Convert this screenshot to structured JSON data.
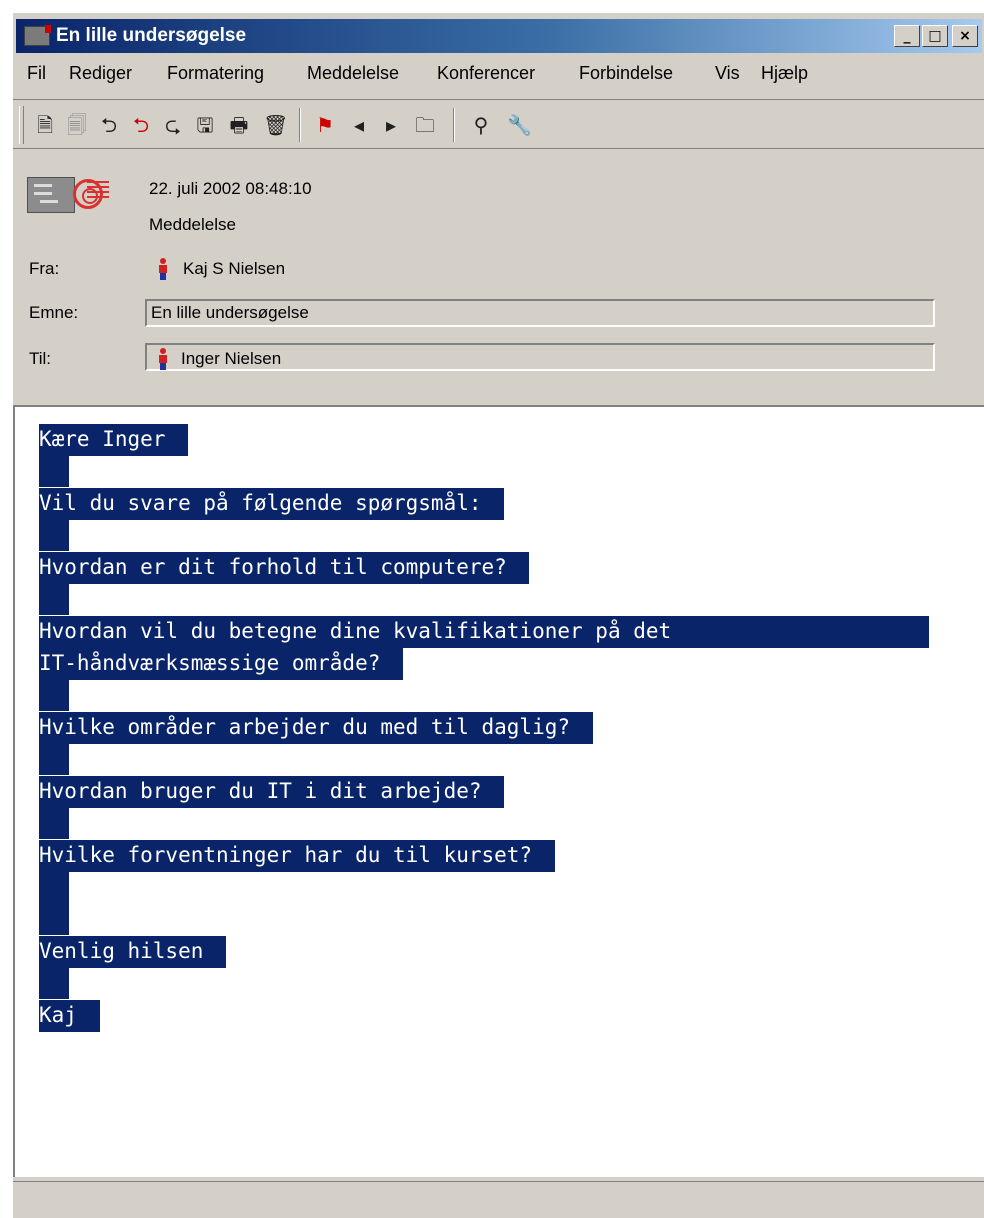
{
  "window": {
    "title": "En lille undersøgelse",
    "controls": {
      "minimize": "_",
      "maximize": "□",
      "close": "×"
    }
  },
  "menu": [
    "Fil",
    "Rediger",
    "Formatering",
    "Meddelelse",
    "Konferencer",
    "Forbindelse",
    "Vis",
    "Hjælp"
  ],
  "toolbar_icons": [
    "new-message-icon",
    "new-reply-icon",
    "reply-icon",
    "reply-all-icon",
    "forward-icon",
    "save-icon",
    "print-icon",
    "delete-icon",
    "flag-icon",
    "previous-icon",
    "next-icon",
    "folder-icon",
    "search-icon",
    "tools-icon"
  ],
  "header": {
    "date": "22. juli 2002 08:48:10",
    "type": "Meddelelse",
    "from_label": "Fra:",
    "from_value": "Kaj S Nielsen",
    "subject_label": "Emne:",
    "subject_value": "En lille undersøgelse",
    "to_label": "Til:",
    "to_value": "Inger Nielsen"
  },
  "body": {
    "lines": [
      "Kære Inger ",
      "",
      "Vil du svare på følgende spørgsmål: ",
      "",
      "Hvordan er dit forhold til computere? ",
      "",
      "Hvordan vil du betegne dine kvalifikationer på det",
      "IT-håndværksmæssige område? ",
      "",
      "Hvilke områder arbejder du med til daglig? ",
      "",
      "Hvordan bruger du IT i dit arbejde? ",
      "",
      "Hvilke forventninger har du til kurset? ",
      "",
      "",
      "Venlig hilsen ",
      "",
      "Kaj "
    ]
  },
  "colors": {
    "selection": "#0a246a",
    "title_bar_start": "#0a246a",
    "title_bar_end": "#a6caf0",
    "window_face": "#d4d0c8"
  }
}
